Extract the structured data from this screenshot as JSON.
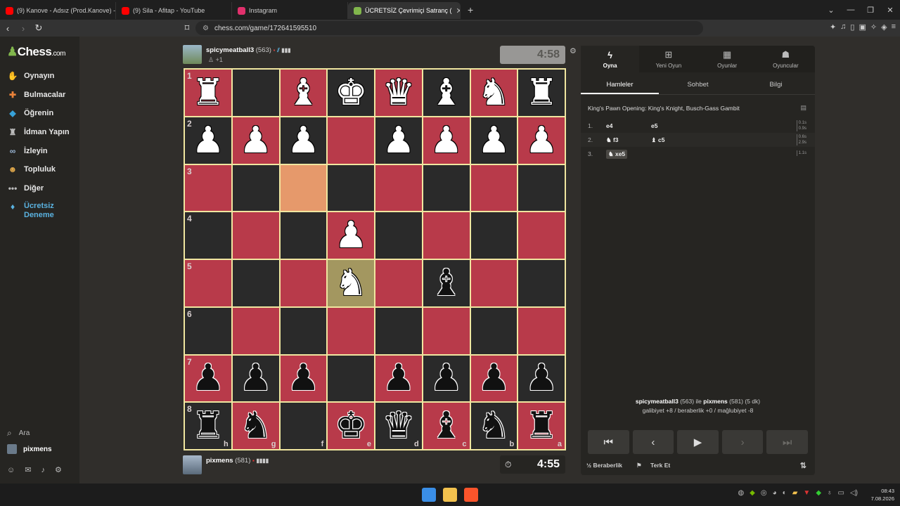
{
  "browser": {
    "tabs": [
      {
        "title": "(9) Kanove - Adsız (Prod.Kanove) - Yo",
        "color": "#ff0000"
      },
      {
        "title": "(9) Sila - Afitap - YouTube",
        "color": "#ff0000"
      },
      {
        "title": "Instagram",
        "color": "#e1306c"
      },
      {
        "title": "ÜCRETSİZ Çevrimiçi Satranç (",
        "color": "#81b64c"
      }
    ],
    "url": "chess.com/game/172641595510",
    "new_tab": "+"
  },
  "sidebar": {
    "logo": "Chess",
    "logo_suffix": ".com",
    "items": [
      {
        "label": "Oynayın",
        "icon": "play-hand-icon"
      },
      {
        "label": "Bulmacalar",
        "icon": "puzzle-icon"
      },
      {
        "label": "Öğrenin",
        "icon": "graduation-cap-icon"
      },
      {
        "label": "İdman Yapın",
        "icon": "drill-icon"
      },
      {
        "label": "İzleyin",
        "icon": "binoculars-icon"
      },
      {
        "label": "Topluluk",
        "icon": "community-icon"
      },
      {
        "label": "Diğer",
        "icon": "more-icon"
      }
    ],
    "premium_line1": "Ücretsiz",
    "premium_line2": "Deneme",
    "search_label": "Ara",
    "user_label": "pixmens"
  },
  "top_player": {
    "name": "spicymeatball3",
    "rating": "(563)",
    "captured": "+1",
    "clock": "4:58"
  },
  "bottom_player": {
    "name": "pixmens",
    "rating": "(581)",
    "clock": "4:55"
  },
  "board": {
    "ranks_labels": [
      "1",
      "2",
      "3",
      "4",
      "5",
      "6",
      "7",
      "8"
    ],
    "files_labels": [
      "h",
      "g",
      "f",
      "e",
      "d",
      "c",
      "b",
      "a"
    ],
    "rows": [
      [
        "wR",
        "",
        "wB",
        "wK",
        "wQ",
        "wB",
        "wN",
        "wR"
      ],
      [
        "wP",
        "wP",
        "wP",
        "",
        "wP",
        "wP",
        "wP",
        "wP"
      ],
      [
        "",
        "",
        "",
        "",
        "",
        "",
        "",
        ""
      ],
      [
        "",
        "",
        "",
        "wP",
        "",
        "",
        "",
        ""
      ],
      [
        "",
        "",
        "",
        "wN",
        "",
        "bB",
        "",
        ""
      ],
      [
        "",
        "",
        "",
        "",
        "",
        "",
        "",
        ""
      ],
      [
        "bP",
        "bP",
        "bP",
        "",
        "bP",
        "bP",
        "bP",
        "bP"
      ],
      [
        "bR",
        "bN",
        "",
        "bK",
        "bQ",
        "bB",
        "bN",
        "bR"
      ]
    ],
    "highlight_from": [
      2,
      2
    ],
    "highlight_to": [
      4,
      3
    ]
  },
  "panel": {
    "tabs": [
      {
        "label": "Oyna",
        "icon": "lightning-icon"
      },
      {
        "label": "Yeni Oyun",
        "icon": "plus-square-icon"
      },
      {
        "label": "Oyunlar",
        "icon": "board-icon"
      },
      {
        "label": "Oyuncular",
        "icon": "players-icon"
      }
    ],
    "subtabs": [
      "Hamleler",
      "Sohbet",
      "Bilgi"
    ],
    "opening": "King's Pawn Opening: King's Knight, Busch-Gass Gambit",
    "moves": [
      {
        "num": "1.",
        "white": "e4",
        "black": "e5",
        "t1": "0.1s",
        "t2": "0.9s"
      },
      {
        "num": "2.",
        "white": "♞ f3",
        "black": "♝ c5",
        "t1": "0.6s",
        "t2": "2.9s"
      },
      {
        "num": "3.",
        "white": "♞ xe5",
        "black": "",
        "t1": "1.1s",
        "t2": ""
      }
    ],
    "game_line1_white": "spicymeatball3",
    "game_line1_mid": "(563) ile",
    "game_line1_black": "pixmens",
    "game_line1_end": "(581) (5 dk)",
    "game_line2": "galibiyet +8 / beraberlik +0 / mağlubiyet -8",
    "draw_label": "Beraberlik",
    "resign_label": "Terk Et"
  },
  "taskbar": {
    "time": "08:43",
    "date": "7.08.2026"
  }
}
